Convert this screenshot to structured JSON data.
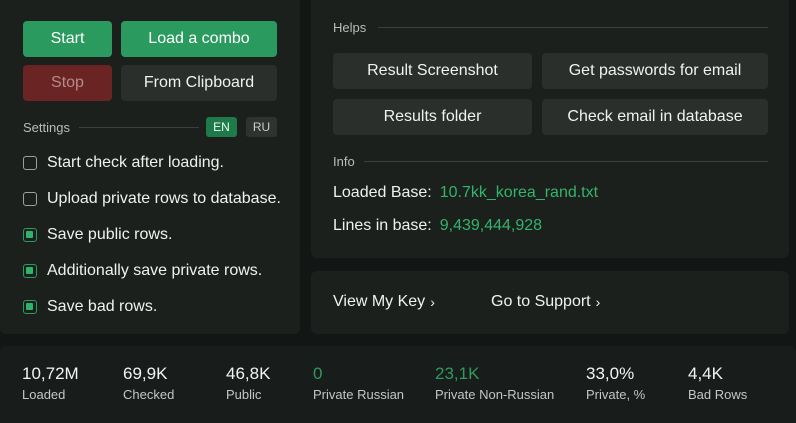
{
  "controls": {
    "start": "Start",
    "load_combo": "Load a combo",
    "stop": "Stop",
    "from_clipboard": "From Clipboard"
  },
  "settings": {
    "title": "Settings",
    "lang_en": "EN",
    "lang_ru": "RU",
    "options": [
      {
        "label": "Start check after loading.",
        "checked": false
      },
      {
        "label": "Upload private rows to database.",
        "checked": false
      },
      {
        "label": "Save public rows.",
        "checked": true
      },
      {
        "label": "Additionally save private rows.",
        "checked": true
      },
      {
        "label": "Save bad rows.",
        "checked": true
      }
    ]
  },
  "helps": {
    "title": "Helps",
    "result_screenshot": "Result Screenshot",
    "get_passwords": "Get passwords for email",
    "results_folder": "Results folder",
    "check_email": "Check email in database"
  },
  "info": {
    "title": "Info",
    "loaded_base_label": "Loaded Base:",
    "loaded_base_value": "10.7kk_korea_rand.txt",
    "lines_label": "Lines in base:",
    "lines_value": "9,439,444,928"
  },
  "links": {
    "view_key": "View My Key",
    "support": "Go to Support"
  },
  "stats": [
    {
      "value": "10,72M",
      "label": "Loaded"
    },
    {
      "value": "69,9K",
      "label": "Checked"
    },
    {
      "value": "46,8K",
      "label": "Public"
    },
    {
      "value": "0",
      "label": "Private Russian"
    },
    {
      "value": "23,1K",
      "label": "Private Non-Russian"
    },
    {
      "value": "33,0%",
      "label": "Private, %"
    },
    {
      "value": "4,4K",
      "label": "Bad Rows"
    }
  ],
  "colors": {
    "accent_green": "#2a9a5f",
    "value_green": "#33b36d",
    "stop_red": "#6b2424",
    "background": "#121614"
  }
}
